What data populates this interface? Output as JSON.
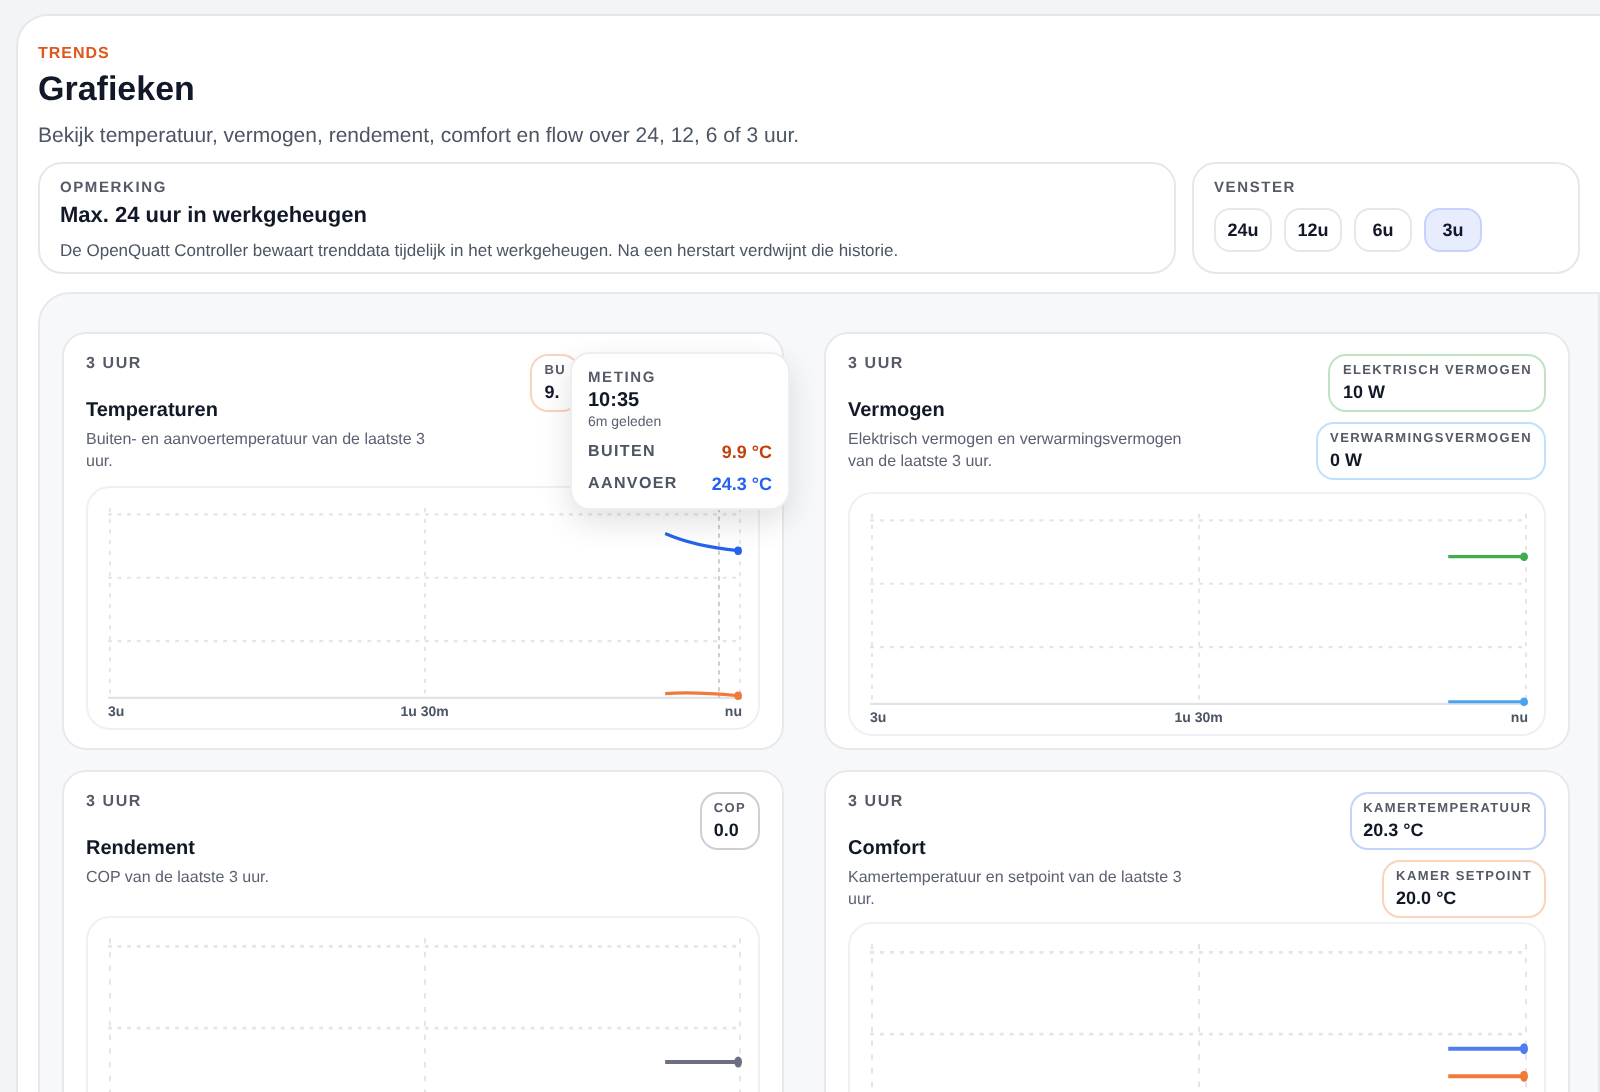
{
  "header": {
    "eyebrow": "TRENDS",
    "title": "Grafieken",
    "subtitle": "Bekijk temperatuur, vermogen, rendement, comfort en flow over 24, 12, 6 of 3 uur."
  },
  "note": {
    "label": "OPMERKING",
    "title": "Max. 24 uur in werkgeheugen",
    "text": "De OpenQuatt Controller bewaart trenddata tijdelijk in het werkgeheugen. Na een herstart verdwijnt die historie."
  },
  "window": {
    "label": "VENSTER",
    "options": [
      {
        "label": "24u",
        "selected": false
      },
      {
        "label": "12u",
        "selected": false
      },
      {
        "label": "6u",
        "selected": false
      },
      {
        "label": "3u",
        "selected": true
      }
    ]
  },
  "charts": [
    {
      "range": "3 UUR",
      "title": "Temperaturen",
      "description": "Buiten- en aanvoertemperatuur van de laatste 3 uur.",
      "stats": [
        {
          "label": "BU",
          "value": "9.",
          "color": "#f07a3a"
        }
      ],
      "axis_labels": [
        "3u",
        "1u 30m",
        "nu"
      ],
      "tooltip": {
        "label": "METING",
        "time": "10:35",
        "ago": "6m geleden",
        "rows": [
          {
            "label": "BUITEN",
            "value": "9.9 °C",
            "color": "#c2410c"
          },
          {
            "label": "AANVOER",
            "value": "24.3 °C",
            "color": "#2563eb"
          }
        ]
      }
    },
    {
      "range": "3 UUR",
      "title": "Vermogen",
      "description": "Elektrisch vermogen en verwarmingsvermogen van de laatste 3 uur.",
      "stats": [
        {
          "label": "ELEKTRISCH VERMOGEN",
          "value": "10 W",
          "color": "#3fae4a"
        },
        {
          "label": "VERWARMINGSVERMOGEN",
          "value": "0 W",
          "color": "#4aa3f0"
        }
      ],
      "axis_labels": [
        "3u",
        "1u 30m",
        "nu"
      ]
    },
    {
      "range": "3 UUR",
      "title": "Rendement",
      "description": "COP van de laatste 3 uur.",
      "stats": [
        {
          "label": "COP",
          "value": "0.0",
          "color": "#6b6f80"
        }
      ]
    },
    {
      "range": "3 UUR",
      "title": "Comfort",
      "description": "Kamertemperatuur en setpoint van de laatste 3 uur.",
      "stats": [
        {
          "label": "KAMERTEMPERATUUR",
          "value": "20.3 °C",
          "color": "#4f7cf0"
        },
        {
          "label": "KAMER SETPOINT",
          "value": "20.0 °C",
          "color": "#f07a3a"
        }
      ]
    }
  ]
}
